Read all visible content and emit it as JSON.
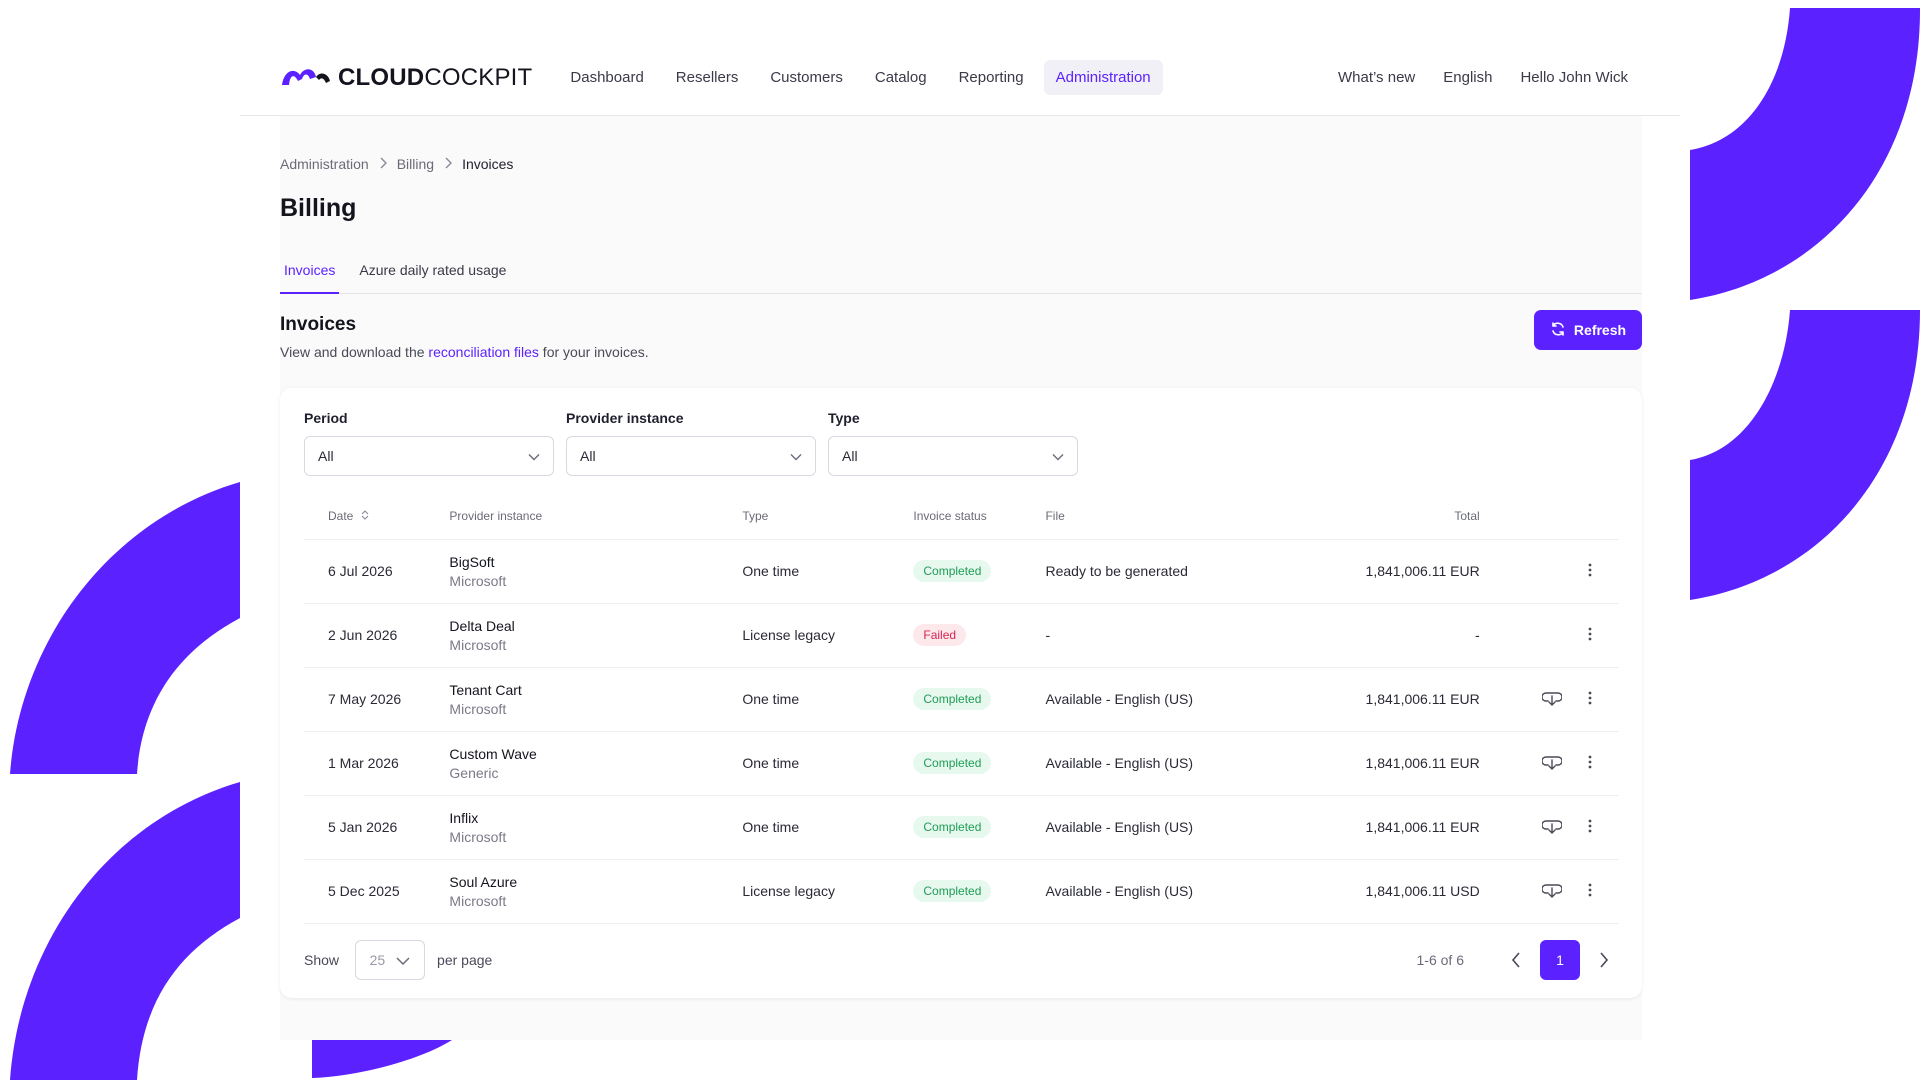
{
  "brand": {
    "logo_text_bold": "CLOUD",
    "logo_text_light": "COCKPIT",
    "accent": "#5b21ff"
  },
  "nav": {
    "items": [
      {
        "label": "Dashboard"
      },
      {
        "label": "Resellers"
      },
      {
        "label": "Customers"
      },
      {
        "label": "Catalog"
      },
      {
        "label": "Reporting"
      },
      {
        "label": "Administration",
        "active": true
      }
    ],
    "whats_new": "What’s new",
    "language": "English",
    "greeting": "Hello John Wick"
  },
  "breadcrumb": [
    "Administration",
    "Billing",
    "Invoices"
  ],
  "page_title": "Billing",
  "tabs": [
    {
      "label": "Invoices",
      "active": true
    },
    {
      "label": "Azure daily rated usage"
    }
  ],
  "section": {
    "title": "Invoices",
    "desc_before": "View and download the ",
    "desc_link": "reconciliation files",
    "desc_after": " for your invoices.",
    "refresh_label": "Refresh"
  },
  "filters": [
    {
      "label": "Period",
      "value": "All"
    },
    {
      "label": "Provider instance",
      "value": "All"
    },
    {
      "label": "Type",
      "value": "All"
    }
  ],
  "table": {
    "headers": {
      "date": "Date",
      "provider": "Provider instance",
      "type": "Type",
      "status": "Invoice status",
      "file": "File",
      "total": "Total"
    },
    "rows": [
      {
        "date": "6 Jul 2026",
        "provider": "BigSoft",
        "vendor": "Microsoft",
        "type": "One time",
        "status": "Completed",
        "file": "Ready to be generated",
        "total": "1,841,006.11 EUR",
        "download": false
      },
      {
        "date": "2 Jun 2026",
        "provider": "Delta Deal",
        "vendor": "Microsoft",
        "type": "License legacy",
        "status": "Failed",
        "file": "-",
        "total": "-",
        "download": false
      },
      {
        "date": "7 May 2026",
        "provider": "Tenant Cart",
        "vendor": "Microsoft",
        "type": "One time",
        "status": "Completed",
        "file": "Available - English (US)",
        "total": "1,841,006.11 EUR",
        "download": true
      },
      {
        "date": "1 Mar 2026",
        "provider": "Custom Wave",
        "vendor": "Generic",
        "type": "One time",
        "status": "Completed",
        "file": "Available - English (US)",
        "total": "1,841,006.11 EUR",
        "download": true
      },
      {
        "date": "5 Jan 2026",
        "provider": "Inflix",
        "vendor": "Microsoft",
        "type": "One time",
        "status": "Completed",
        "file": "Available - English (US)",
        "total": "1,841,006.11 EUR",
        "download": true
      },
      {
        "date": "5 Dec 2025",
        "provider": "Soul Azure",
        "vendor": "Microsoft",
        "type": "License legacy",
        "status": "Completed",
        "file": "Available - English (US)",
        "total": "1,841,006.11 USD",
        "download": true
      }
    ]
  },
  "pagination": {
    "show": "Show",
    "per_page_value": "25",
    "per_page": "per page",
    "range": "1-6 of 6",
    "current_page": "1"
  }
}
